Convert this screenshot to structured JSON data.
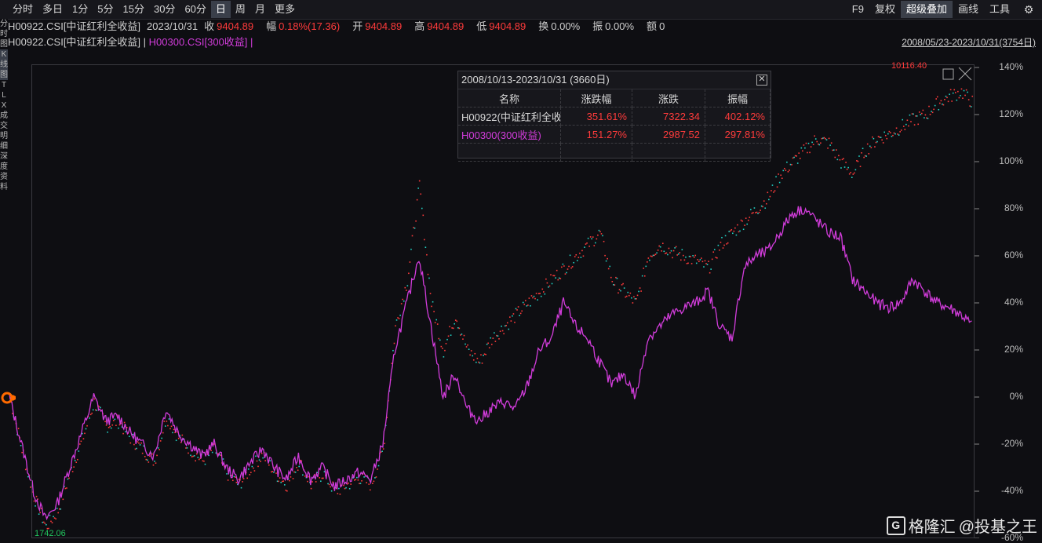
{
  "toolbar": {
    "periods": [
      "分时",
      "多日",
      "1分",
      "5分",
      "15分",
      "30分",
      "60分",
      "日",
      "周",
      "月",
      "更多"
    ],
    "active_period": "日",
    "right": [
      "F9",
      "复权",
      "超级叠加",
      "画线",
      "工具"
    ],
    "active_right": "超级叠加",
    "gear_icon": "gear-icon"
  },
  "stats": {
    "code": "H00922.CSI[中证红利全收益]",
    "date": "2023/10/31",
    "close_label": "收",
    "close_value": "9404.89",
    "change_label": "幅",
    "change_value": "0.18%(17.36)",
    "open_label": "开",
    "open_value": "9404.89",
    "high_label": "高",
    "high_value": "9404.89",
    "low_label": "低",
    "low_value": "9404.89",
    "turnover_label": "换",
    "turnover_value": "0.00%",
    "amplitude_label": "振",
    "amplitude_value": "0.00%",
    "amount_label": "额",
    "amount_value": "0"
  },
  "legend": {
    "series1": "H00922.CSI[中证红利全收益] |",
    "series2": "H00300.CSI[300收益] |"
  },
  "range_label": "2008/05/23-2023/10/31(3754日)",
  "sidebar": [
    "分",
    "时",
    "图",
    "K",
    "线",
    "图",
    "T",
    "L",
    "X",
    "成",
    "交",
    "明",
    "细",
    "深",
    "度",
    "资",
    "料"
  ],
  "popup": {
    "title": "2008/10/13-2023/10/31 (3660日)",
    "headers": [
      "名称",
      "涨跌幅",
      "涨跌",
      "振幅"
    ],
    "rows": [
      {
        "name": "H00922(中证红利全收",
        "pct": "351.61%",
        "chg": "7322.34",
        "amp": "402.12%"
      },
      {
        "name": "H00300(300收益)",
        "pct": "151.27%",
        "chg": "2987.52",
        "amp": "297.81%"
      }
    ]
  },
  "y_axis": [
    "140%",
    "120%",
    "100%",
    "80%",
    "60%",
    "40%",
    "20%",
    "0%",
    "-20%",
    "-40%",
    "-60%"
  ],
  "max_label": "10116.40",
  "min_label": "1742.06",
  "watermark": {
    "brand": "格隆汇",
    "handle": "@投基之王",
    "icon": "g-logo-icon"
  },
  "colors": {
    "series1": "#ff3b3b",
    "series1_alt": "#22d3c5",
    "series2": "#d23cdb",
    "accent": "#ff6a00"
  },
  "chart_data": {
    "type": "line",
    "title": "",
    "xlabel": "",
    "ylabel": "",
    "ylim": [
      -60,
      140
    ],
    "series": [
      {
        "name": "H00300(300收益)",
        "values": [
          0,
          -20,
          -40,
          -52,
          -45,
          -30,
          -15,
          0,
          -10,
          -8,
          -15,
          -20,
          -25,
          -5,
          -15,
          -20,
          -25,
          -20,
          -30,
          -35,
          -28,
          -22,
          -30,
          -35,
          -25,
          -35,
          -30,
          -38,
          -35,
          -32,
          -35,
          -20,
          20,
          40,
          60,
          30,
          0,
          10,
          -5,
          -10,
          -5,
          -2,
          -5,
          5,
          20,
          25,
          40,
          30,
          25,
          15,
          5,
          10,
          0,
          25,
          30,
          35,
          38,
          40,
          45,
          30,
          25,
          55,
          60,
          62,
          70,
          78,
          80,
          75,
          70,
          68,
          50,
          45,
          40,
          38,
          40,
          50,
          45,
          40,
          38,
          35,
          30
        ]
      },
      {
        "name": "H00922(中证红利全收",
        "values": [
          0,
          -22,
          -42,
          -55,
          -48,
          -32,
          -18,
          -2,
          -12,
          -10,
          -17,
          -22,
          -27,
          -8,
          -17,
          -22,
          -27,
          -22,
          -32,
          -37,
          -30,
          -24,
          -32,
          -37,
          -27,
          -37,
          -32,
          -40,
          -37,
          -34,
          -37,
          -22,
          30,
          50,
          90,
          40,
          20,
          35,
          20,
          15,
          25,
          30,
          35,
          40,
          45,
          50,
          55,
          60,
          65,
          70,
          50,
          45,
          40,
          60,
          65,
          62,
          60,
          58,
          55,
          65,
          70,
          75,
          80,
          85,
          95,
          100,
          105,
          110,
          108,
          100,
          95,
          105,
          110,
          112,
          115,
          118,
          120,
          125,
          128,
          130,
          125
        ]
      }
    ]
  }
}
